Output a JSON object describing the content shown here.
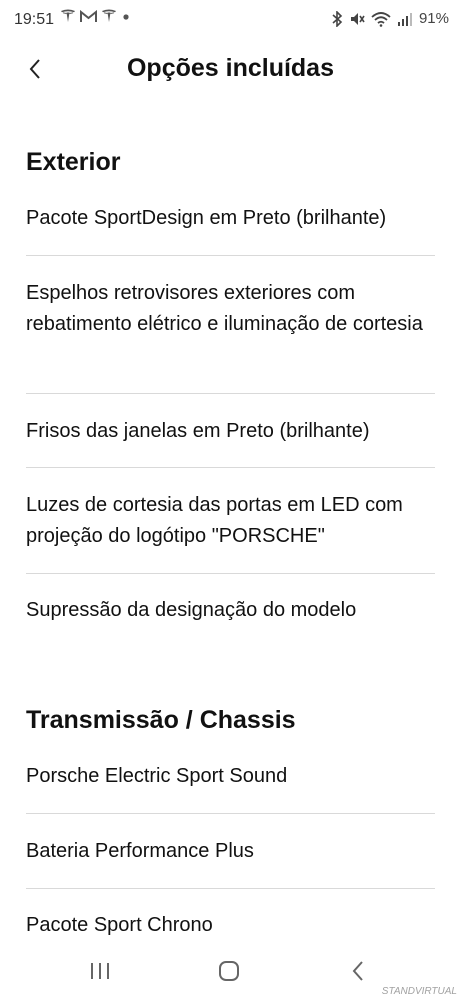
{
  "status_bar": {
    "time": "19:51",
    "battery": "91%",
    "left_icons": [
      "tesla-icon",
      "gmail-icon",
      "tesla-icon",
      "dot-icon"
    ],
    "right_icons": [
      "bluetooth-icon",
      "mute-icon",
      "wifi-icon",
      "signal-icon"
    ]
  },
  "header": {
    "title": "Opções incluídas",
    "back_icon": "chevron-left-icon"
  },
  "sections": [
    {
      "title": "Exterior",
      "items": [
        "Pacote SportDesign em Preto (brilhante)",
        "Espelhos retrovisores exteriores com rebatimento elétrico e iluminação de cortesia",
        "Frisos das janelas em Preto (brilhante)",
        "Luzes de cortesia das portas em LED com projeção do logótipo \"PORSCHE\"",
        "Supressão da designação do modelo"
      ]
    },
    {
      "title": "Transmissão / Chassis",
      "items": [
        "Porsche Electric Sport Sound",
        "Bateria Performance Plus",
        "Pacote Sport Chrono"
      ]
    }
  ],
  "nav_bar": {
    "icons": [
      "recent-apps-icon",
      "home-icon",
      "back-icon"
    ]
  },
  "watermark": "STANDVIRTUAL",
  "colors": {
    "text": "#111111",
    "divider": "#d9d9d9",
    "background": "#ffffff"
  }
}
